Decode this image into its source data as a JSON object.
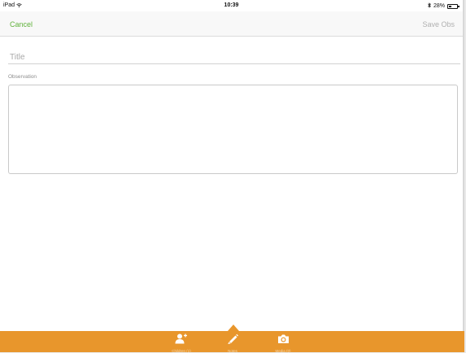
{
  "status_bar": {
    "device": "iPad",
    "time": "10:39",
    "battery": "28%",
    "battery_level": 0.28
  },
  "nav": {
    "cancel_label": "Cancel",
    "save_label": "Save Obs"
  },
  "form": {
    "title_placeholder": "Title",
    "title_value": "",
    "observation_label": "Observation",
    "observation_value": ""
  },
  "tabs": [
    {
      "label": "Children (1)",
      "icon": "add-person-icon"
    },
    {
      "label": "Notes",
      "icon": "pencil-icon"
    },
    {
      "label": "Media (0)",
      "icon": "camera-icon"
    }
  ],
  "colors": {
    "accent_green": "#5fb23a",
    "tab_bar_orange": "#e8962c"
  }
}
